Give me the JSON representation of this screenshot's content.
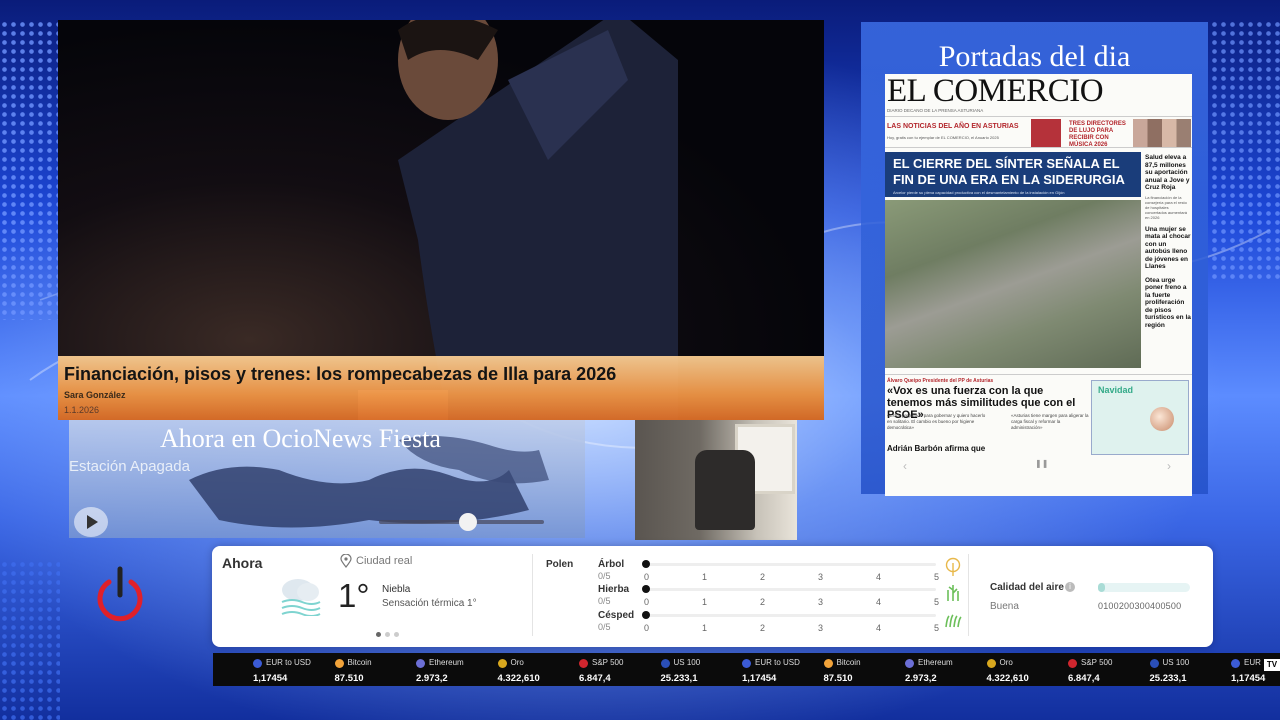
{
  "hero": {
    "headline": "Financiación, pisos y trenes: los rompecabezas de Illa para 2026",
    "author": "Sara González",
    "date": "1.1.2026"
  },
  "portadas": {
    "title": "Portadas del dia",
    "paper": {
      "masthead": "EL COMERCIO",
      "subline": "DIARIO DECANO DE LA PRENSA ASTURIANA",
      "band_left": "LAS NOTICIAS DEL AÑO EN ASTURIAS",
      "band_left_sub": "Hoy, gratis con tu ejemplar de EL COMERCIO, el Anuario 2025",
      "band_right": "TRES DIRECTORES DE LUJO PARA RECIBIR CON MÚSICA 2026",
      "lead_headline": "EL CIERRE DEL SÍNTER SEÑALA EL FIN DE UNA ERA EN LA SIDERURGIA",
      "lead_sub": "Arcelor pierde su plena capacidad productiva con el desmantelamiento de la instalación en Gijón",
      "side": [
        {
          "h": "Salud eleva a 87,5 millones su aportación anual a Jove y Cruz Roja",
          "p": "La financiación de la consejería para el resto de hospitales concertados aumentará en 2026"
        },
        {
          "h": "Una mujer se mata al chocar con un autobús lleno de jóvenes en Llanes",
          "p": ""
        },
        {
          "h": "Otea urge poner freno a la fuerte proliferación de pisos turísticos en la región",
          "p": ""
        }
      ],
      "kicker": "Álvaro Queipo Presidente del PP de Asturias",
      "quote": "«Vox es una fuerza con la que tenemos más similitudes que con el PSOE»",
      "quote_p1": "«Estoy preparado para gobernar y quiero hacerlo en solitario. El cambio es bueno por higiene democrática»",
      "quote_p2": "«Asturias tiene margen para aligerar la carga fiscal y reformar la administración»",
      "bottom_headline": "Adrián Barbón afirma que",
      "ad_text": "Navidad"
    }
  },
  "ocio": {
    "title": "Ahora en OcioNews Fiesta",
    "status": "Estación Apagada"
  },
  "weather": {
    "now_label": "Ahora",
    "city": "Ciudad real",
    "temperature": "1°",
    "condition": "Niebla",
    "feels_like": "Sensación térmica 1°",
    "pollen_label": "Polen",
    "pollen_scale": [
      "0",
      "1",
      "2",
      "3",
      "4",
      "5"
    ],
    "pollen": [
      {
        "name": "Árbol",
        "value": "0/5",
        "level": 0,
        "icon": "tree-icon"
      },
      {
        "name": "Hierba",
        "value": "0/5",
        "level": 0,
        "icon": "grass-icon"
      },
      {
        "name": "Césped",
        "value": "0/5",
        "level": 0,
        "icon": "lawn-icon"
      }
    ],
    "air_quality_label": "Calidad del aire",
    "air_quality_value": "Buena",
    "air_quality_scale": "0100200300400500",
    "air_quality_level": 0.08
  },
  "ticker": [
    {
      "name": "EUR to USD",
      "value": "1,17454",
      "color": "#3b5bd6"
    },
    {
      "name": "Bitcoin",
      "value": "87.510",
      "color": "#f2a33a"
    },
    {
      "name": "Ethereum",
      "value": "2.973,2",
      "color": "#6c6fd6"
    },
    {
      "name": "Oro",
      "value": "4.322,610",
      "color": "#d9a81e"
    },
    {
      "name": "S&P 500",
      "value": "6.847,4",
      "color": "#d0262e"
    },
    {
      "name": "US 100",
      "value": "25.233,1",
      "color": "#2a4fb8"
    },
    {
      "name": "EUR to USD",
      "value": "1,17454",
      "color": "#3b5bd6"
    },
    {
      "name": "Bitcoin",
      "value": "87.510",
      "color": "#f2a33a"
    },
    {
      "name": "Ethereum",
      "value": "2.973,2",
      "color": "#6c6fd6"
    },
    {
      "name": "Oro",
      "value": "4.322,610",
      "color": "#d9a81e"
    },
    {
      "name": "S&P 500",
      "value": "6.847,4",
      "color": "#d0262e"
    },
    {
      "name": "US 100",
      "value": "25.233,1",
      "color": "#2a4fb8"
    },
    {
      "name": "EUR",
      "value": "1,17454",
      "color": "#3b5bd6"
    }
  ],
  "ticker_logo": "TV",
  "colors": {
    "accent_orange": "#e8843a",
    "power_red": "#e0202a",
    "panel_blue": "#3c6ee6"
  }
}
